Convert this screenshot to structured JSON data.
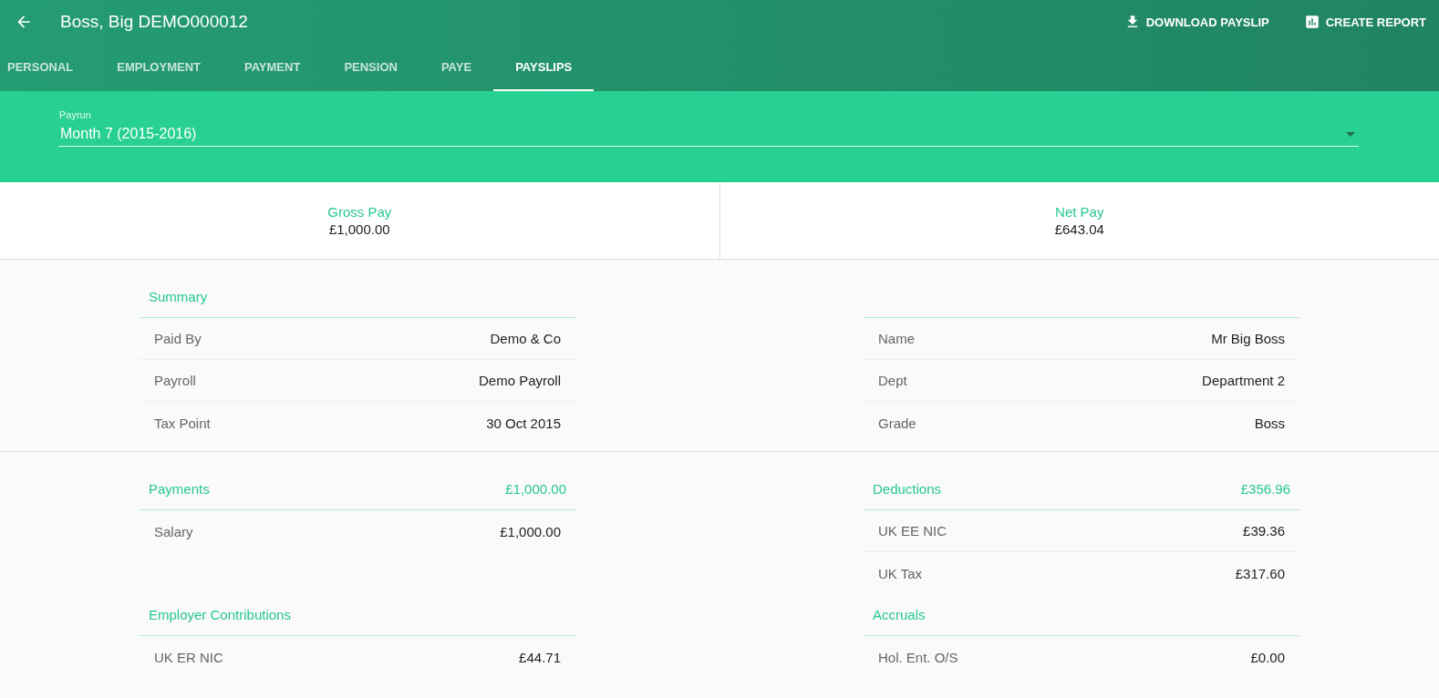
{
  "header": {
    "title": "Boss, Big DEMO000012",
    "actions": [
      {
        "label": "DOWNLOAD PAYSLIP",
        "kind": "download"
      },
      {
        "label": "CREATE REPORT",
        "kind": "report"
      }
    ]
  },
  "tabs": [
    {
      "label": "PERSONAL",
      "selected": false
    },
    {
      "label": "EMPLOYMENT",
      "selected": false
    },
    {
      "label": "PAYMENT",
      "selected": false
    },
    {
      "label": "PENSION",
      "selected": false
    },
    {
      "label": "PAYE",
      "selected": false
    },
    {
      "label": "PAYSLIPS",
      "selected": true
    }
  ],
  "payrun": {
    "label": "Payrun",
    "value": "Month 7 (2015-2016)"
  },
  "totals": [
    {
      "label": "Gross Pay",
      "value": "£1,000.00"
    },
    {
      "label": "Net Pay",
      "value": "£643.04"
    }
  ],
  "sections": [
    {
      "panels": [
        {
          "title": "Summary",
          "rows": [
            {
              "label": "Paid By",
              "value": "Demo & Co"
            },
            {
              "label": "Payroll",
              "value": "Demo Payroll"
            },
            {
              "label": "Tax Point",
              "value": "30 Oct 2015"
            }
          ]
        },
        {
          "rows": [
            {
              "label": "Name",
              "value": "Mr Big Boss"
            },
            {
              "label": "Dept",
              "value": "Department 2"
            },
            {
              "label": "Grade",
              "value": "Boss"
            }
          ]
        }
      ]
    },
    {
      "panels": [
        {
          "title": "Payments",
          "total": "£1,000.00",
          "rows": [
            {
              "label": "Salary",
              "value": "£1,000.00"
            }
          ]
        },
        {
          "title": "Deductions",
          "total": "£356.96",
          "rows": [
            {
              "label": "UK EE NIC",
              "value": "£39.36"
            },
            {
              "label": "UK Tax",
              "value": "£317.60"
            }
          ]
        },
        {
          "title": "Employer Contributions",
          "rows": [
            {
              "label": "UK ER NIC",
              "value": "£44.71"
            }
          ]
        },
        {
          "title": "Accruals",
          "rows": [
            {
              "label": "Hol. Ent. O/S",
              "value": "£0.00"
            }
          ]
        }
      ]
    }
  ]
}
